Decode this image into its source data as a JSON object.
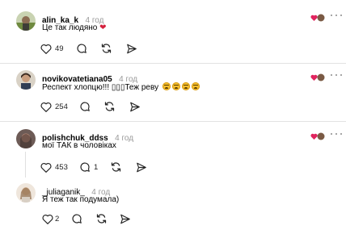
{
  "comments": [
    {
      "username": "alin_ka_k",
      "time": "4 год",
      "text": "Це так людяно",
      "text_emoji": "❤",
      "likes": "49",
      "replies": ""
    },
    {
      "username": "novikovatetiana05",
      "time": "4 год",
      "text": "Респект хлопцю!!! ▯▯▯Теж реву",
      "likes": "254",
      "replies": ""
    },
    {
      "username": "polishchuk_ddss",
      "time": "4 год",
      "text": "мої ТАК в чоловіках",
      "likes": "453",
      "replies": "1"
    },
    {
      "username": "_juliaganik_",
      "time": "4 год",
      "text": "Я теж так подумала)",
      "likes": "2",
      "replies": ""
    }
  ],
  "icons": {
    "like": "heart-outline-icon",
    "reply": "speech-bubble-icon",
    "repost": "repost-icon",
    "share": "send-icon",
    "more": "more-dots-icon",
    "creator_liked": "creator-liked-badge-icon"
  },
  "colors": {
    "heart_red": "#e0245e",
    "muted_text": "#999999",
    "divider": "#e2e2e2"
  }
}
